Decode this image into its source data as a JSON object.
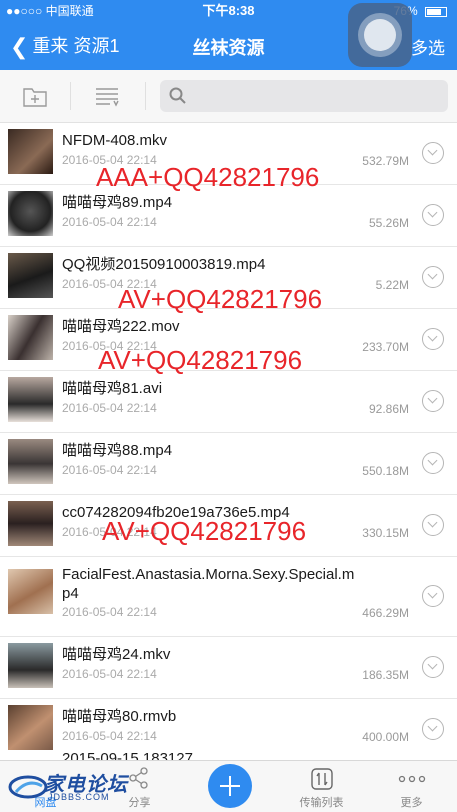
{
  "status_bar": {
    "carrier": "●●○○○ 中国联通",
    "time": "下午8:38",
    "battery": "76%",
    "battery_level": 0.76
  },
  "nav": {
    "back_label": "重来 资源1",
    "title": "丝袜资源",
    "multi_select": "多选"
  },
  "search": {
    "placeholder": ""
  },
  "files": [
    {
      "name": "NFDM-408.mkv",
      "date": "2016-05-04 22:14",
      "size": "532.79M"
    },
    {
      "name": "喵喵母鸡89.mp4",
      "date": "2016-05-04 22:14",
      "size": "55.26M"
    },
    {
      "name": "QQ视频20150910003819.mp4",
      "date": "2016-05-04 22:14",
      "size": "5.22M"
    },
    {
      "name": "喵喵母鸡222.mov",
      "date": "2016-05-04 22:14",
      "size": "233.70M"
    },
    {
      "name": "喵喵母鸡81.avi",
      "date": "2016-05-04 22:14",
      "size": "92.86M"
    },
    {
      "name": "喵喵母鸡88.mp4",
      "date": "2016-05-04 22:14",
      "size": "550.18M"
    },
    {
      "name": "cc074282094fb20e19a736e5.mp4",
      "date": "2016-05-04 22:14",
      "size": "330.15M"
    },
    {
      "name": "FacialFest.Anastasia.Morna.Sexy.Special.mp4",
      "date": "2016-05-04 22:14",
      "size": "466.29M"
    },
    {
      "name": "喵喵母鸡24.mkv",
      "date": "2016-05-04 22:14",
      "size": "186.35M"
    },
    {
      "name": "喵喵母鸡80.rmvb",
      "date": "2016-05-04 22:14",
      "size": "400.00M"
    }
  ],
  "partial_row": "2015-09-15 183127",
  "overlays": [
    "AAA+QQ42821796",
    "AV+QQ42821796",
    "AV+QQ42821796",
    "AV+QQ42821796"
  ],
  "tabbar": {
    "tabs": [
      {
        "label": "网盘",
        "icon": "cloud-icon",
        "active": true
      },
      {
        "label": "分享",
        "icon": "share-icon",
        "active": false
      },
      {
        "label": "",
        "icon": "plus-icon",
        "active": false
      },
      {
        "label": "传输列表",
        "icon": "transfer-icon",
        "active": false
      },
      {
        "label": "更多",
        "icon": "more-icon",
        "active": false
      }
    ]
  },
  "watermark": {
    "main": "家电论坛",
    "sub": "JDBBS.COM"
  },
  "colors": {
    "accent": "#2f8bf0",
    "overlay_text": "#e8252a",
    "watermark": "#1f4ea0"
  }
}
